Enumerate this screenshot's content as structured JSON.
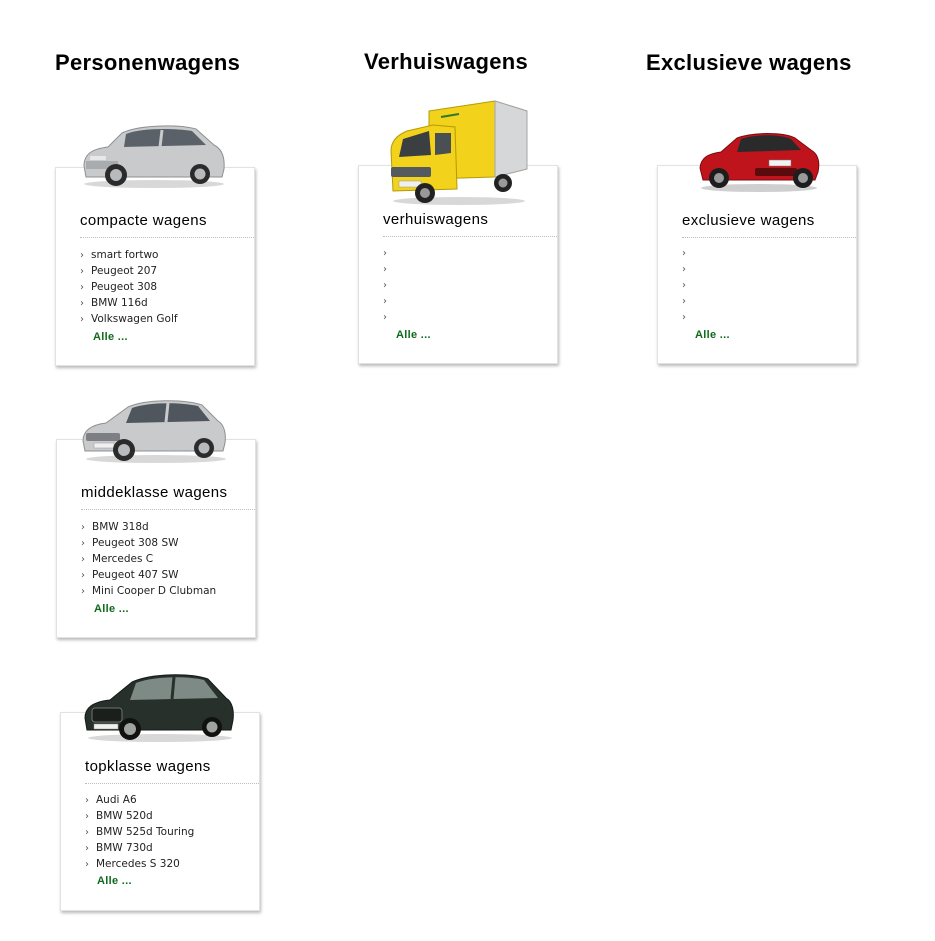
{
  "columns": [
    {
      "heading": "Personenwagens",
      "categories": [
        {
          "title": "compacte wagens",
          "image": "silver-hatchback-car",
          "items": [
            "smart fortwo",
            "Peugeot 207",
            "Peugeot 308",
            "BMW 116d",
            "Volkswagen Golf"
          ],
          "more": "Alle ..."
        },
        {
          "title": "middeklasse wagens",
          "image": "silver-sedan-car",
          "items": [
            "BMW 318d",
            "Peugeot 308 SW",
            "Mercedes C",
            "Peugeot 407 SW",
            "Mini Cooper D Clubman"
          ],
          "more": "Alle ..."
        },
        {
          "title": "topklasse wagens",
          "image": "dark-green-sedan-car",
          "items": [
            "Audi A6",
            "BMW 520d",
            "BMW 525d Touring",
            "BMW 730d",
            "Mercedes S 320"
          ],
          "more": "Alle ..."
        }
      ]
    },
    {
      "heading": "Verhuiswagens",
      "categories": [
        {
          "title": "verhuiswagens",
          "image": "yellow-box-van",
          "items": [
            "",
            "",
            "",
            "",
            ""
          ],
          "more": "Alle ..."
        }
      ]
    },
    {
      "heading": "Exclusieve wagens",
      "categories": [
        {
          "title": "exclusieve wagens",
          "image": "red-sports-car",
          "items": [
            "",
            "",
            "",
            "",
            ""
          ],
          "more": "Alle ..."
        }
      ]
    }
  ],
  "colors": {
    "link_green": "#0e6b1c",
    "card_border": "#e2e2e2",
    "car_silver": "#c8cacc",
    "van_yellow": "#f2d21b",
    "car_red": "#c0141c",
    "car_dark": "#27302b"
  }
}
